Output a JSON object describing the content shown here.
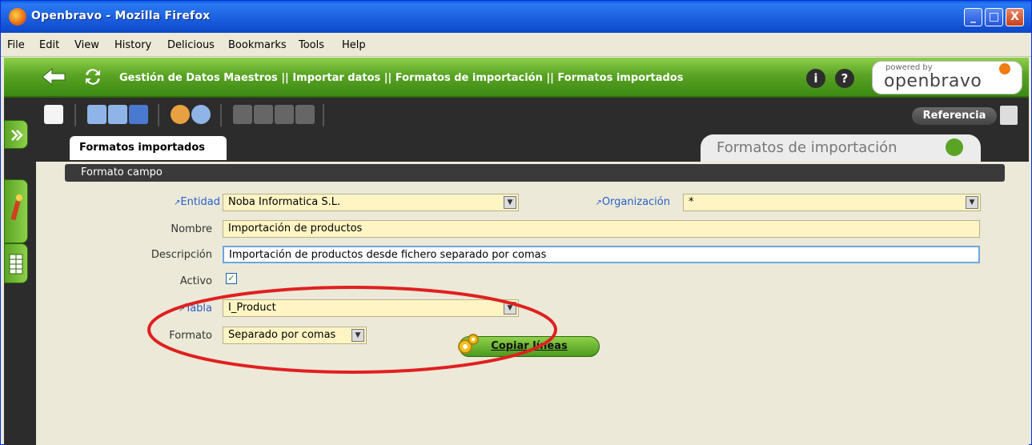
{
  "window": {
    "title": "Openbravo - Mozilla Firefox",
    "buttons": [
      "_",
      "□",
      "X"
    ]
  },
  "menubar": [
    "File",
    "Edit",
    "View",
    "History",
    "Delicious",
    "Bookmarks",
    "Tools",
    "Help"
  ],
  "navbar": {
    "breadcrumb": "Gestión de Datos Maestros || Importar datos || Formatos de importación || Formatos importados",
    "info_label": "i",
    "help_label": "?",
    "logo_small": "powered by",
    "logo_big": "openbravo"
  },
  "toolbar": {
    "reference_label": "Referencia"
  },
  "tabs": {
    "active": "Formatos importados",
    "right_title": "Formatos de importación"
  },
  "section": {
    "title": "Formato campo"
  },
  "form": {
    "entidad_label": "Entidad",
    "entidad_value": "Noba Informatica S.L.",
    "organizacion_label": "Organización",
    "organizacion_value": "*",
    "nombre_label": "Nombre",
    "nombre_value": "Importación de productos",
    "descripcion_label": "Descripción",
    "descripcion_value": "Importación de productos desde fichero separado por comas",
    "activo_label": "Activo",
    "activo_checked": true,
    "tabla_label": "Tabla",
    "tabla_value": "I_Product",
    "formato_label": "Formato",
    "formato_value": "Separado por comas"
  },
  "actions": {
    "copy_label": "Copiar líneas"
  },
  "icons": [
    "firefox-icon",
    "back-arrow-icon",
    "refresh-icon",
    "info-icon",
    "help-icon",
    "new-record-icon",
    "save-icon",
    "undo-icon",
    "search-icon",
    "first-record-icon",
    "previous-record-icon",
    "next-record-icon",
    "last-record-icon",
    "reference-icon",
    "edit-tab-icon",
    "grid-tab-icon",
    "gear-icon"
  ]
}
